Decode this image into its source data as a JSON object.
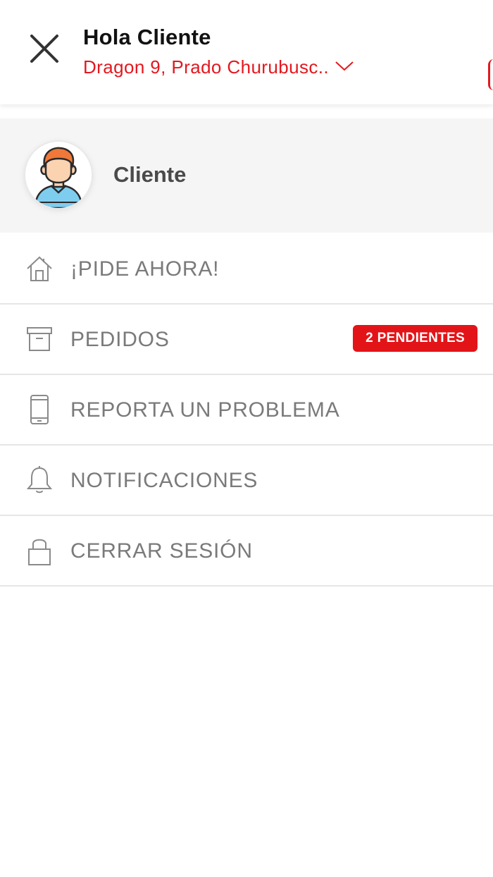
{
  "header": {
    "greeting": "Hola Cliente",
    "address": "Dragon 9, Prado Churubusc..",
    "close_icon": "close-icon",
    "chevron_icon": "chevron-down-icon"
  },
  "profile": {
    "name": "Cliente",
    "avatar_icon": "user-avatar"
  },
  "menu": {
    "items": [
      {
        "label": "¡PIDE AHORA!",
        "icon": "home-icon"
      },
      {
        "label": "PEDIDOS",
        "icon": "archive-box-icon",
        "badge": "2 PENDIENTES"
      },
      {
        "label": "REPORTA UN PROBLEMA",
        "icon": "phone-icon"
      },
      {
        "label": "NOTIFICACIONES",
        "icon": "bell-icon"
      },
      {
        "label": "CERRAR SESIÓN",
        "icon": "lock-icon"
      }
    ]
  },
  "colors": {
    "accent": "#e3191f",
    "badge_bg": "#e31418",
    "menu_text": "#7a7a7a",
    "profile_bg": "#f5f5f5"
  }
}
